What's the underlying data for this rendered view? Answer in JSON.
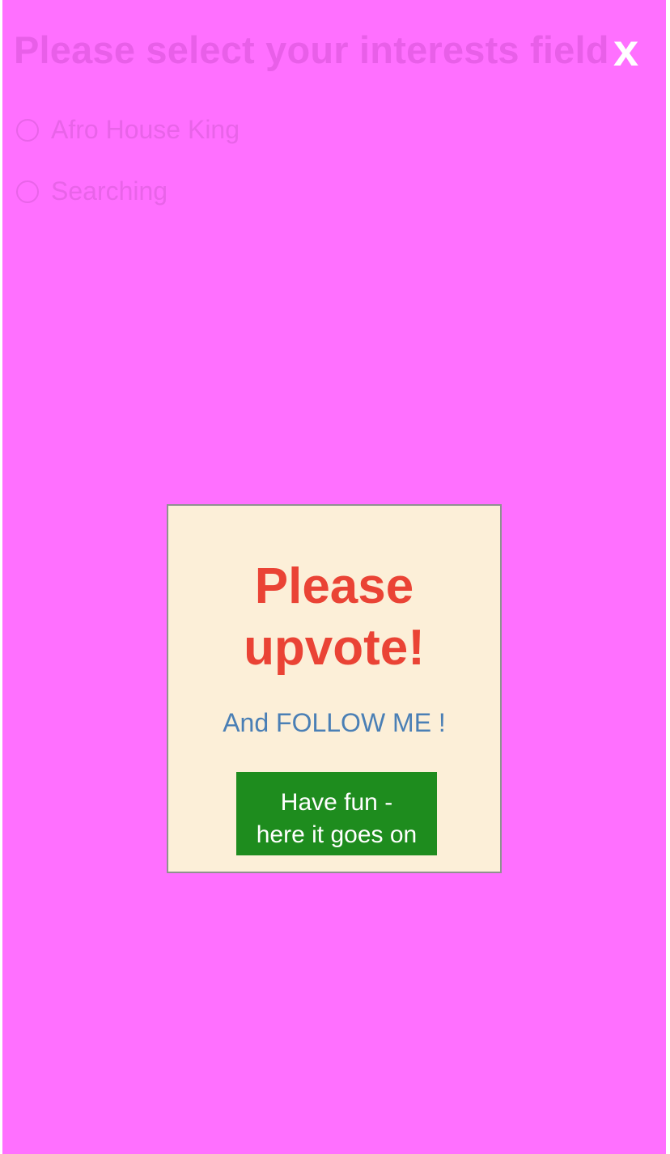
{
  "header": {
    "title": "Please select your interests field",
    "close_label": "x"
  },
  "options": [
    {
      "label": "Afro House King"
    },
    {
      "label": "Searching"
    }
  ],
  "modal": {
    "title_line1": "Please",
    "title_line2": "upvote!",
    "subtitle": "And FOLLOW ME !",
    "button_line1": "Have fun -",
    "button_line2": "here it goes on"
  },
  "colors": {
    "background": "#ff70ff",
    "modal_background": "#fcefd8",
    "title_red": "#ea4335",
    "subtitle_blue": "#4a7fb5",
    "button_green": "#1e8c1e"
  }
}
